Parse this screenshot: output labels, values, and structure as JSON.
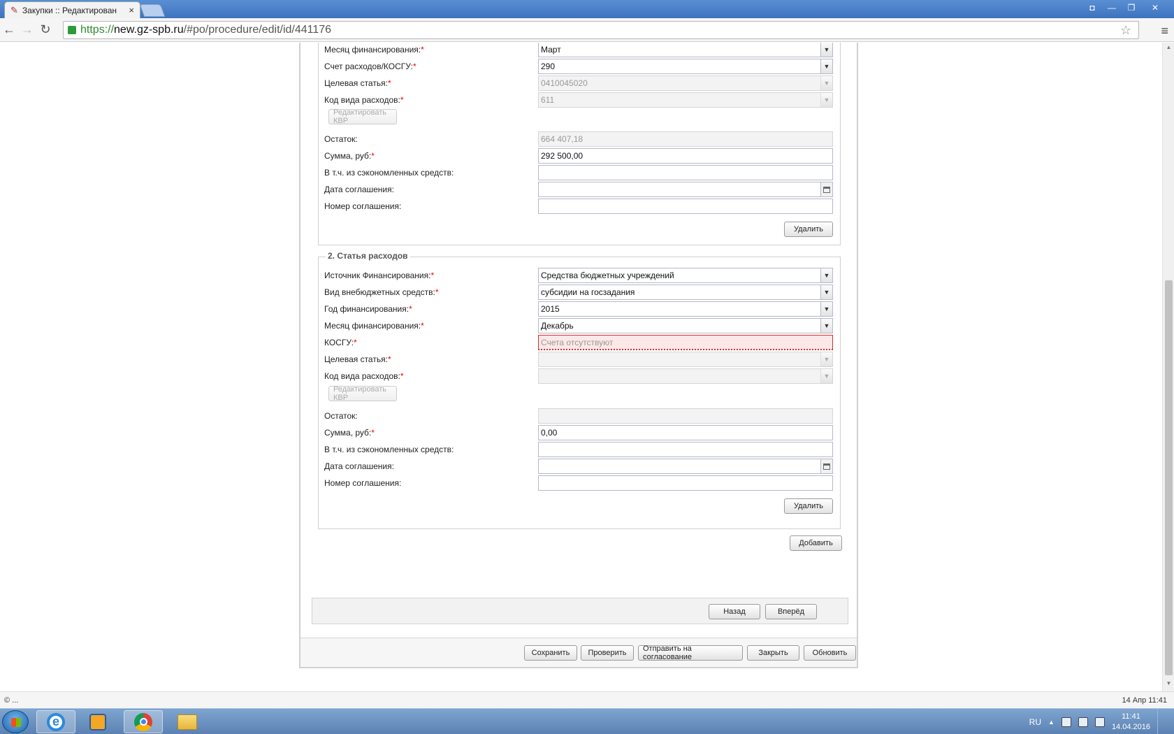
{
  "browser": {
    "tab_title": "Закупки :: Редактирован",
    "tab_close": "×",
    "url_scheme": "https://",
    "url_host": "new.gz-spb.ru",
    "url_path": "/#po/procedure/edit/id/441176",
    "back_glyph": "←",
    "forward_glyph": "→",
    "reload_glyph": "↻",
    "star_glyph": "☆",
    "menu_glyph": "≡"
  },
  "section1": {
    "rows": [
      {
        "label": "Месяц финансирования:",
        "value": "Март"
      },
      {
        "label": "Счет расходов/КОСГУ:",
        "value": "290"
      },
      {
        "label": "Целевая статья:",
        "value": "0410045020"
      },
      {
        "label": "Код вида расходов:",
        "value": "611"
      },
      {
        "label": "Остаток:",
        "value": "664 407,18"
      },
      {
        "label": "Сумма, руб:",
        "value": "292 500,00"
      },
      {
        "label": "В т.ч. из сэкономленных средств:",
        "value": ""
      },
      {
        "label": "Дата соглашения:",
        "value": ""
      },
      {
        "label": "Номер соглашения:",
        "value": ""
      }
    ],
    "edit_kvr_label": "Редактировать КВР",
    "delete_label": "Удалить"
  },
  "section2": {
    "legend": "2. Статья расходов",
    "rows": [
      {
        "label": "Источник Финансирования:",
        "value": "Средства бюджетных учреждений"
      },
      {
        "label": "Вид внебюджетных средств:",
        "value": "субсидии на госзадания"
      },
      {
        "label": "Год финансирования:",
        "value": "2015"
      },
      {
        "label": "Месяц финансирования:",
        "value": "Декабрь"
      },
      {
        "label": "КОСГУ:",
        "value": "Счета отсутствуют"
      },
      {
        "label": "Целевая статья:",
        "value": ""
      },
      {
        "label": "Код вида расходов:",
        "value": ""
      },
      {
        "label": "Остаток:",
        "value": ""
      },
      {
        "label": "Сумма, руб:",
        "value": "0,00"
      },
      {
        "label": "В т.ч. из сэкономленных средств:",
        "value": ""
      },
      {
        "label": "Дата соглашения:",
        "value": ""
      },
      {
        "label": "Номер соглашения:",
        "value": ""
      }
    ],
    "edit_kvr_label": "Редактировать КВР",
    "delete_label": "Удалить"
  },
  "required_mark": "*",
  "add_label": "Добавить",
  "nav": {
    "back": "Назад",
    "forward": "Вперёд"
  },
  "footer": {
    "save": "Сохранить",
    "check": "Проверить",
    "send": "Отправить на согласование",
    "close": "Закрыть",
    "refresh": "Обновить"
  },
  "statusbar": {
    "left": "© ...",
    "right": "14 Апр 11:41"
  },
  "taskbar": {
    "lang": "RU",
    "time": "11:41",
    "date": "14.04.2016",
    "tray_arrow": "▲"
  },
  "colors": {
    "accent": "#3d72bf",
    "required": "#ee0000",
    "invalid_bg": "#fde8e8"
  }
}
